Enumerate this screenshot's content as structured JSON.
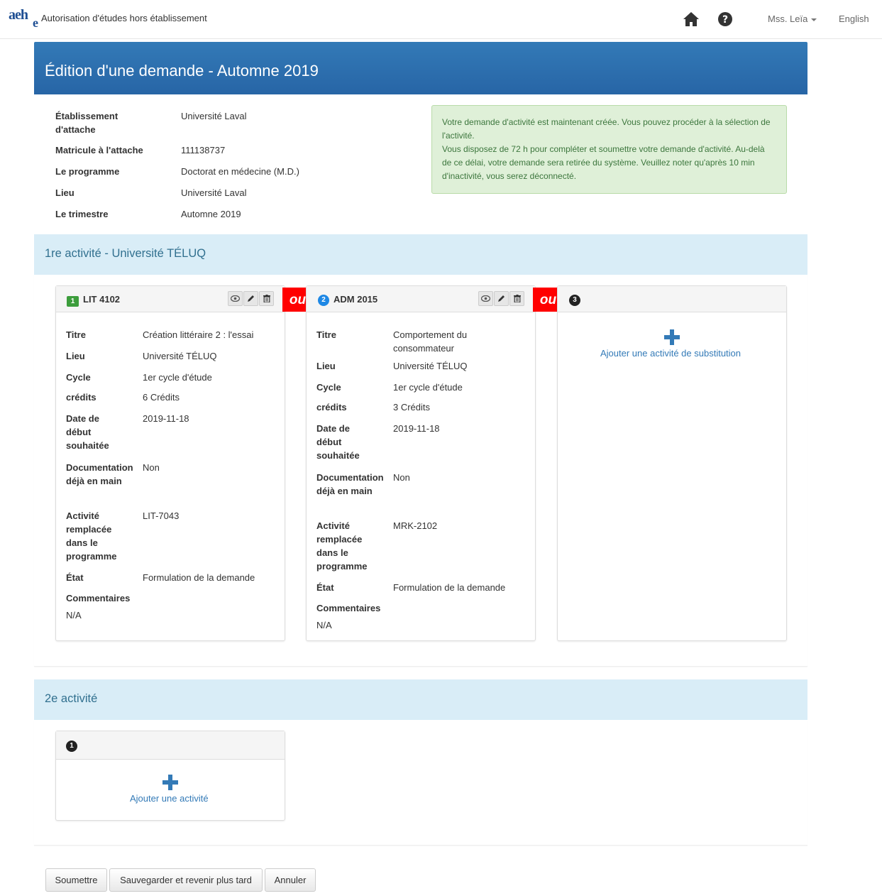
{
  "nav": {
    "logo_line1": "aeh",
    "logo_line2": "e",
    "app_title": "Autorisation d'études hors établissement",
    "user": "Mss. Leïa",
    "language": "English"
  },
  "page": {
    "title": "Édition d'une demande - Automne 2019"
  },
  "request_info": [
    {
      "label": "Établissement d'attache",
      "value": "Université Laval"
    },
    {
      "label": "Matricule à l'attache",
      "value": "111138737"
    },
    {
      "label": "Le programme",
      "value": "Doctorat en médecine (M.D.)"
    },
    {
      "label": "Lieu",
      "value": "Université Laval"
    },
    {
      "label": "Le trimestre",
      "value": "Automne 2019"
    }
  ],
  "alert": {
    "line1": "Votre demande d'activité est maintenant créée. Vous pouvez procéder à la sélection de l'activité.",
    "line2": "Vous disposez de 72 h pour compléter et soumettre votre demande d'activité. Au-delà de ce délai, votre demande sera retirée du système. Veuillez noter qu'après 10 min d'inactivité, vous serez déconnecté."
  },
  "section1": {
    "title": "1re activité - Université TÉLUQ",
    "or_label": "ou",
    "cards": [
      {
        "number": "1",
        "code": "LIT 4102",
        "fields": {
          "titre_label": "Titre",
          "titre": "Création littéraire 2 : l'essai",
          "lieu_label": "Lieu",
          "lieu": "Université TÉLUQ",
          "cycle_label": "Cycle",
          "cycle": "1er cycle d'étude",
          "credits_label": "crédits",
          "credits": "6 Crédits",
          "date_label": "Date de début souhaitée",
          "date": "2019-11-18",
          "doc_label": "Documentation déjà en main",
          "doc": "Non",
          "replaced_label": "Activité remplacée dans le programme",
          "replaced": "LIT-7043",
          "etat_label": "État",
          "etat": "Formulation de la demande",
          "comments_label": "Commentaires",
          "comments": "N/A"
        }
      },
      {
        "number": "2",
        "code": "ADM 2015",
        "fields": {
          "titre_label": "Titre",
          "titre": "Comportement du consommateur",
          "lieu_label": "Lieu",
          "lieu": "Université TÉLUQ",
          "cycle_label": "Cycle",
          "cycle": "1er cycle d'étude",
          "credits_label": "crédits",
          "credits": "3 Crédits",
          "date_label": "Date de début souhaitée",
          "date": "2019-11-18",
          "doc_label": "Documentation déjà en main",
          "doc": "Non",
          "replaced_label": "Activité remplacée dans le programme",
          "replaced": "MRK-2102",
          "etat_label": "État",
          "etat": "Formulation de la demande",
          "comments_label": "Commentaires",
          "comments": "N/A"
        }
      },
      {
        "number": "3",
        "add_label": "Ajouter une activité de substitution"
      }
    ]
  },
  "section2": {
    "title": "2e activité",
    "card": {
      "number": "1",
      "add_label": "Ajouter une activité"
    }
  },
  "actions": {
    "submit": "Soumettre",
    "save_later": "Sauvegarder et revenir plus tard",
    "cancel": "Annuler"
  },
  "colors": {
    "header_blue": "#337ab7",
    "section_bg": "#d9edf7",
    "ou_red": "#ff0000",
    "badge_green": "#3c9d3c",
    "badge_blue": "#1e88e5",
    "alert_bg": "#dff0d8"
  },
  "icons": [
    "home-icon",
    "question-circle-icon",
    "eye-icon",
    "pencil-icon",
    "trash-icon",
    "plus-icon"
  ]
}
